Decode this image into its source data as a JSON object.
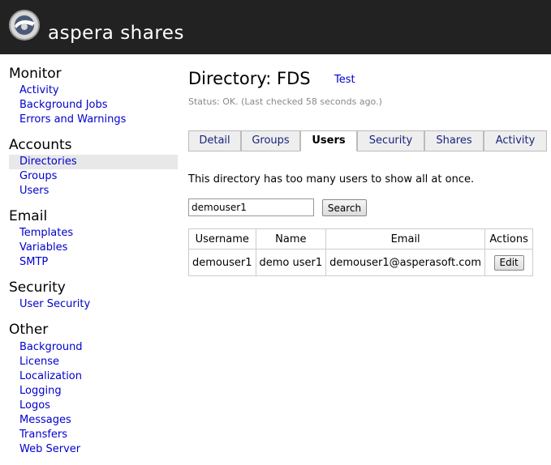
{
  "header": {
    "brand": "aspera shares",
    "logo_icon": "aspera-logo-icon"
  },
  "sidebar": {
    "sections": [
      {
        "title": "Monitor",
        "items": [
          {
            "label": "Activity"
          },
          {
            "label": "Background Jobs"
          },
          {
            "label": "Errors and Warnings"
          }
        ]
      },
      {
        "title": "Accounts",
        "items": [
          {
            "label": "Directories",
            "active": true
          },
          {
            "label": "Groups"
          },
          {
            "label": "Users"
          }
        ]
      },
      {
        "title": "Email",
        "items": [
          {
            "label": "Templates"
          },
          {
            "label": "Variables"
          },
          {
            "label": "SMTP"
          }
        ]
      },
      {
        "title": "Security",
        "items": [
          {
            "label": "User Security"
          }
        ]
      },
      {
        "title": "Other",
        "items": [
          {
            "label": "Background"
          },
          {
            "label": "License"
          },
          {
            "label": "Localization"
          },
          {
            "label": "Logging"
          },
          {
            "label": "Logos"
          },
          {
            "label": "Messages"
          },
          {
            "label": "Transfers"
          },
          {
            "label": "Web Server"
          }
        ]
      }
    ]
  },
  "main": {
    "title": "Directory: FDS",
    "test_link": "Test",
    "status": "Status: OK. (Last checked 58 seconds ago.)",
    "tabs": [
      {
        "label": "Detail"
      },
      {
        "label": "Groups"
      },
      {
        "label": "Users",
        "active": true
      },
      {
        "label": "Security"
      },
      {
        "label": "Shares"
      },
      {
        "label": "Activity"
      }
    ],
    "notice": "This directory has too many users to show all at once.",
    "search": {
      "value": "demouser1",
      "button_label": "Search"
    },
    "table": {
      "headers": [
        "Username",
        "Name",
        "Email",
        "Actions"
      ],
      "rows": [
        {
          "username": "demouser1",
          "name": "demo user1",
          "email": "demouser1@asperasoft.com",
          "action_label": "Edit"
        }
      ]
    }
  },
  "colors": {
    "header_bg": "#222222",
    "link": "#0000cc",
    "active_nav_bg": "#e8e8e8",
    "tab_bg": "#eeeeee"
  }
}
